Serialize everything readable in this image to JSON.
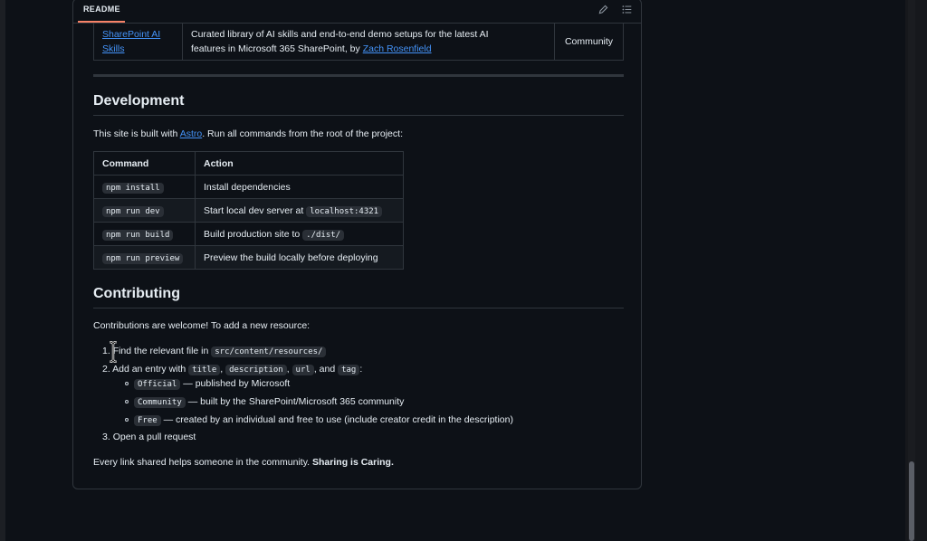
{
  "readme": {
    "tab_label": "README",
    "icons": {
      "edit": "pencil-icon",
      "toc": "list-icon"
    }
  },
  "resource_row": {
    "name_line1": "SharePoint AI",
    "name_line2": "Skills",
    "desc_line1": "Curated library of AI skills and end-to-end demo setups for the latest AI",
    "desc_line2_prefix": "features in Microsoft 365 SharePoint, by ",
    "author": "Zach Rosenfield",
    "tag": "Community"
  },
  "development": {
    "heading": "Development",
    "intro_prefix": "This site is built with ",
    "intro_link": "Astro",
    "intro_suffix": ". Run all commands from the root of the project:",
    "table": {
      "headers": [
        "Command",
        "Action"
      ],
      "rows": [
        {
          "command": "npm install",
          "action": "Install dependencies",
          "action_code": ""
        },
        {
          "command": "npm run dev",
          "action": "Start local dev server at ",
          "action_code": "localhost:4321"
        },
        {
          "command": "npm run build",
          "action": "Build production site to ",
          "action_code": "./dist/"
        },
        {
          "command": "npm run preview",
          "action": "Preview the build locally before deploying",
          "action_code": ""
        }
      ]
    }
  },
  "contributing": {
    "heading": "Contributing",
    "intro": "Contributions are welcome! To add a new resource:",
    "step1_num": "1.",
    "step1_text": "Find the relevant file in ",
    "step1_code": "src/content/resources/",
    "step2_num": "2.",
    "step2_text": "Add an entry with ",
    "step2_codes": [
      "title",
      "description",
      "url",
      "tag"
    ],
    "step2_seps": [
      ", ",
      ", ",
      ", and ",
      ":"
    ],
    "tags": [
      {
        "code": "Official",
        "text": " — published by Microsoft"
      },
      {
        "code": "Community",
        "text": " — built by the SharePoint/Microsoft 365 community"
      },
      {
        "code": "Free",
        "text": " — created by an individual and free to use (include creator credit in the description)"
      }
    ],
    "step3_num": "3.",
    "step3_text": "Open a pull request",
    "closing_text": "Every link shared helps someone in the community. ",
    "closing_bold": "Sharing is Caring."
  }
}
